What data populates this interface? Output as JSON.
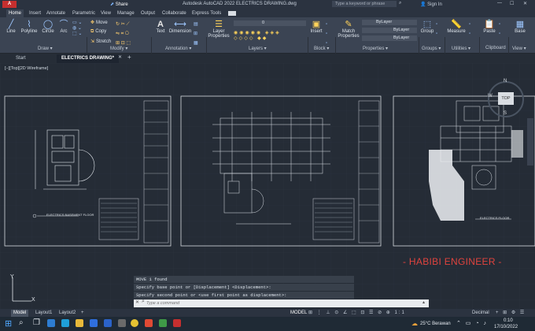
{
  "title_bar": {
    "share": "Share",
    "app_title": "Autodesk AutoCAD 2022   ELECTRICS DRAWING.dwg",
    "search_placeholder": "Type a keyword or phrase",
    "sign_in": "Sign In"
  },
  "ribbon_tabs": [
    "Home",
    "Insert",
    "Annotate",
    "Parametric",
    "View",
    "Manage",
    "Output",
    "Collaborate",
    "Express Tools"
  ],
  "draw_tools": [
    "Line",
    "Polyline",
    "Circle",
    "Arc"
  ],
  "modify_tools": [
    "Move",
    "Copy",
    "Stretch"
  ],
  "annotation_tools": [
    "Text",
    "Dimension"
  ],
  "layers_tool": "Layer Properties",
  "layer_value": "0",
  "insert_tool": "Insert",
  "match_tool": "Match Properties",
  "property_values": [
    "ByLayer",
    "ByLayer",
    "ByLayer"
  ],
  "right_tools": [
    "Group",
    "Measure",
    "Paste",
    "Base"
  ],
  "group_labels": {
    "draw": "Draw",
    "modify": "Modify",
    "annotation": "Annotation",
    "layers": "Layers",
    "block": "Block",
    "properties": "Properties",
    "groups": "Groups",
    "utilities": "Utilities",
    "clipboard": "Clipboard",
    "view": "View"
  },
  "doc_tabs": [
    "Start",
    "ELECTRICS DRAWING*"
  ],
  "viewport_label": "[−][Top][2D Wireframe]",
  "viewcube": {
    "north": "N",
    "top": "TOP",
    "west": "W",
    "south": "S"
  },
  "sheet_titles": [
    "ELECTRICS BASEMENT FLOOR",
    "ELECTRICS FLOOR"
  ],
  "watermark": "- HABIBI ENGINEER -",
  "command_history": [
    "MOVE 1 found",
    "Specify base point or [Displacement] <Displacement>:",
    "Specify second point or <use first point as displacement>:"
  ],
  "command_placeholder": "Type a command",
  "layout_tabs": [
    "Model",
    "Layout1",
    "Layout2"
  ],
  "status": {
    "mode": "MODEL",
    "units": "Decimal"
  },
  "taskbar": {
    "weather": "25°C  Berawan",
    "time": "0:10",
    "date": "17/10/2022"
  },
  "colors": {
    "accent": "#0078d7",
    "watermark": "#e0433e",
    "sheet_border": "#d6dbe0",
    "canvas": "#252c36"
  }
}
